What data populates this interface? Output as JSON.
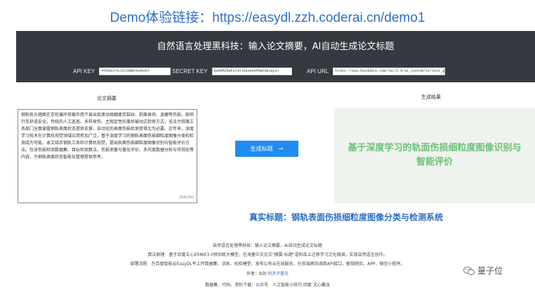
{
  "demo_link": "Demo体验链接：https://easydl.zzh.coderai.cn/demo1",
  "header": {
    "title": "自然语言处理黑科技：输入论文摘要，AI自动生成论文标题",
    "api_key_label": "API KEY",
    "api_key_value": "4lh6GcrXLtOJ3dB64vebokY",
    "secret_key_label": "SECRET KEY",
    "secret_key_value": "qubbM2OwFal4vlDasemnPmWcGm1qyul",
    "api_url_label": "API URL",
    "api_url_value": "https://aip.baidubce.com/rpc/2.0/ai_custom/v1/text_gen/s2_b"
  },
  "main": {
    "abstract_label": "论文摘要",
    "abstract_text": "钢轨轨头踏面在车轮循环荷载作用下易出现滚动接触疲劳裂纹、剥离掉块、波磨等伤损，影响行车舒适安全。传统的人工巡查、多样探伤、主观定性的事后被动式检修方式，无法为铁路工务部门全面掌握钢轨表面状态提供支撑，自动化的表面伤损检测变得尤为必要。近年来，深度学习技术在计算机视觉领域应用愈加广泛，基于深度学习的钢轨表面伤损细粒度图像分类和检测成为可能。本文结合钢轨工务和计算机视觉，提出轨面伤损细粒度图像识别与智能评价方法。包含伤损检测数据集、目标检测算法、伤损测量与量化评价、多尺度数据分析与可视化等内容，为钢轨表面状态智能化管理提供参考。",
    "char_count": "268/300",
    "generate_label": "生成标题",
    "generate_arrow": "→",
    "result_label": "生成结果",
    "result_text": "基于深度学习的轨面伤损细粒度图像识别与智能评价"
  },
  "real_title": "真实标题：钢轨表面伤损细粒度图像分类与检测系统",
  "footer": {
    "line1": "自然语言处理黑科技：输入论文摘要，AI自动生成论文标题",
    "line2": "算法原理　基于百度文心ERNIE3.0预训练大模型，在海量中文论文\"摘要-标题\"语料库上迁移学习泛化微调，实现自然语言创作。",
    "line3": "部署流程　在百度智能云EasyDL平上传数据集、训练、校验模型、发布公有云在线服务，在前端网页调用API接口，解锁网页、APP、微信小程序。",
    "line4_prefix": "作者：B站 ",
    "line4_link": "同济子豪兄",
    "line5": "数据集、代码、资料下载：公众号　人工智能小技巧 回复 文心雕龙"
  },
  "watermark": "量子位",
  "colors": {
    "accent_blue": "#2e6fc4",
    "header_dark": "#343a40",
    "button_blue": "#1f8cf0",
    "result_green": "#6ec07a"
  }
}
